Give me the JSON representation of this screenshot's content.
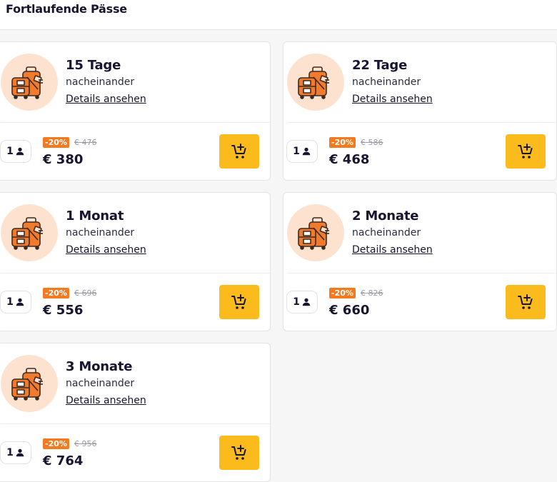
{
  "header": {
    "title": "Fortlaufende Pässe"
  },
  "passes": [
    {
      "title": "15 Tage",
      "subtitle": "nacheinander",
      "details": "Details ansehen",
      "persons": "1",
      "discount": "-20%",
      "old_price": "€ 476",
      "price": "€ 380"
    },
    {
      "title": "22 Tage",
      "subtitle": "nacheinander",
      "details": "Details ansehen",
      "persons": "1",
      "discount": "-20%",
      "old_price": "€ 586",
      "price": "€ 468"
    },
    {
      "title": "1 Monat",
      "subtitle": "nacheinander",
      "details": "Details ansehen",
      "persons": "1",
      "discount": "-20%",
      "old_price": "€ 696",
      "price": "€ 556"
    },
    {
      "title": "2 Monate",
      "subtitle": "nacheinander",
      "details": "Details ansehen",
      "persons": "1",
      "discount": "-20%",
      "old_price": "€ 826",
      "price": "€ 660"
    },
    {
      "title": "3 Monate",
      "subtitle": "nacheinander",
      "details": "Details ansehen",
      "persons": "1",
      "discount": "-20%",
      "old_price": "€ 956",
      "price": "€ 764"
    }
  ],
  "colors": {
    "accent": "#fcbb1d",
    "badge": "#f47a20",
    "avatar_bg": "#fde3cf",
    "icon_orange": "#f27a2c"
  },
  "icons": {
    "luggage": "luggage-icon",
    "person": "person-icon",
    "cart": "add-to-cart-icon"
  }
}
